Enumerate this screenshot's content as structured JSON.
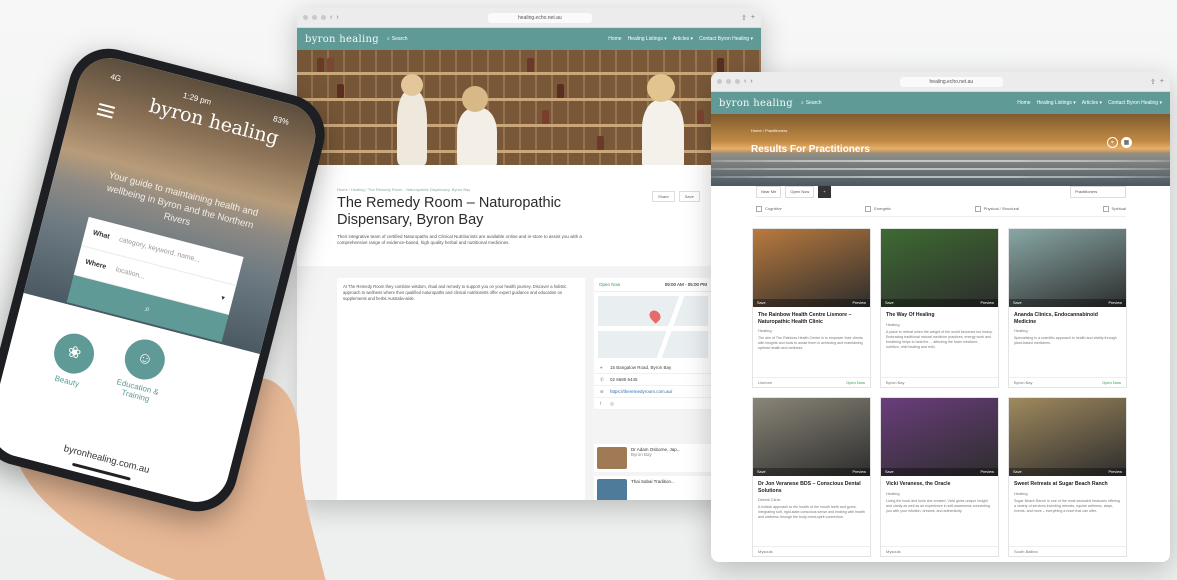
{
  "window1": {
    "url": "healing.echo.net.au",
    "brand": "byron healing",
    "search_label": "Search",
    "nav": [
      "Home",
      "Healing Listings ▾",
      "Articles ▾",
      "Contact Byron Healing ▾"
    ],
    "breadcrumb": "Home / Healing / The Remedy Room - Naturopathic Dispensary, Byron Bay",
    "title": "The Remedy Room – Naturopathic Dispensary, Byron Bay",
    "description": "Their integrative team of certified Naturopaths and Clinical Nutritionists are available online and in-store to assist you with a comprehensive range of evidence-based, high quality herbal and nutritional medicines.",
    "share_label": "Share",
    "save_label": "Save",
    "body_text": "At The Remedy Room they combine wisdom, ritual and remedy to support you on your health journey. Discover a holistic approach to wellness where their qualified naturopaths and clinical nutritionists offer expert guidance and education on supplements and herbs Australia-wide.",
    "hours_status": "Open Now",
    "hours_time": "09:00 AM - 05:00 PM",
    "address": "15 Bangalow Road, Byron Bay",
    "phone": "02 6685 6445",
    "website": "https://theremedyroom.com.au/",
    "related": [
      {
        "name": "Dr Adam Osborne, Jap...",
        "location": "Byron Bay"
      },
      {
        "name": "Thai Sabai Tradition...",
        "location": ""
      }
    ]
  },
  "window2": {
    "url": "healing.echo.net.au",
    "brand": "byron healing",
    "search_label": "Search",
    "nav": [
      "Home",
      "Healing Listings ▾",
      "Articles ▾",
      "Contact Byron Healing ▾"
    ],
    "breadcrumb": "Home / Practitioners",
    "title": "Results For Practitioners",
    "filters": {
      "near_me": "Near Me",
      "open_now": "Open Now",
      "dropdown": "Practitioners"
    },
    "categories": [
      "Cognitive",
      "Energetic",
      "Physical / Structural",
      "Spiritual"
    ],
    "cards": [
      {
        "title": "The Rainbow Health Centre Lismore – Naturopathic Health Clinic",
        "tag": "Healing",
        "text": "The aim of The Rainbow Health Centre is to empower their clients with insights and tools to assist them in achieving and maintaining optimal health and wellness.",
        "location": "Lismore",
        "status": "Open Now",
        "color": "#b97a3e"
      },
      {
        "title": "The Way Of Healing",
        "tag": "Healing",
        "text": "A place to retreat when the weight of the world becomes too heavy. Embracing traditional natural medicine practices, energy work and breathing helps to heal the ... affecting the brain medicine, nutrition, reiki healing and reiki.",
        "location": "Byron Bay",
        "status": "",
        "color": "#3e6b32"
      },
      {
        "title": "Ananda Clinics, Endocannabinoid Medicine",
        "tag": "Healing",
        "text": "Specialising in a scientific approach to health and vitality through plant-based medicines.",
        "location": "Byron Bay",
        "status": "Open Now",
        "color": "#88a7a6"
      },
      {
        "title": "Dr Jon Veranese BDS – Conscious Dental Solutions",
        "tag": "Dental Clinic",
        "text": "A holistic approach to the health of the mouth teeth and gums. Integrating soft, rigid-state conscious sense and healing with health and wellness through the body-mind-spirit connection.",
        "location": "Mysouls",
        "status": "",
        "color": "#8a8578"
      },
      {
        "title": "Vicki Veranese, the Oracle",
        "tag": "Healing",
        "text": "Living the book and tools she created, Vicki gives unique insight and clarity as well as an experience in self-awareness connecting you with your intuition, dreams, and authenticity.",
        "location": "Mysouls",
        "status": "",
        "color": "#6a3d7c"
      },
      {
        "title": "Sweet Retreats at Sugar Beach Ranch",
        "tag": "Healing",
        "text": "Sugar Beach Ranch is one of the most secluded treasures offering a variety of services including retreats, equine wellness, stays, events, and more – everything a reset that can offer.",
        "location": "South Ballina",
        "status": "",
        "color": "#a08a5e"
      }
    ],
    "card_bar": {
      "save": "Save",
      "preview": "Preview"
    }
  },
  "phone": {
    "time": "1:29 pm",
    "network": "4G",
    "battery": "83%",
    "brand": "byron healing",
    "tagline": "Your guide to maintaining health and wellbeing in Byron and the Northern Rivers",
    "what_label": "What",
    "what_placeholder": "category, keyword, name...",
    "where_label": "Where",
    "where_placeholder": "location...",
    "categories": [
      "Beauty",
      "Education & Training"
    ],
    "url": "byronhealing.com.au"
  }
}
